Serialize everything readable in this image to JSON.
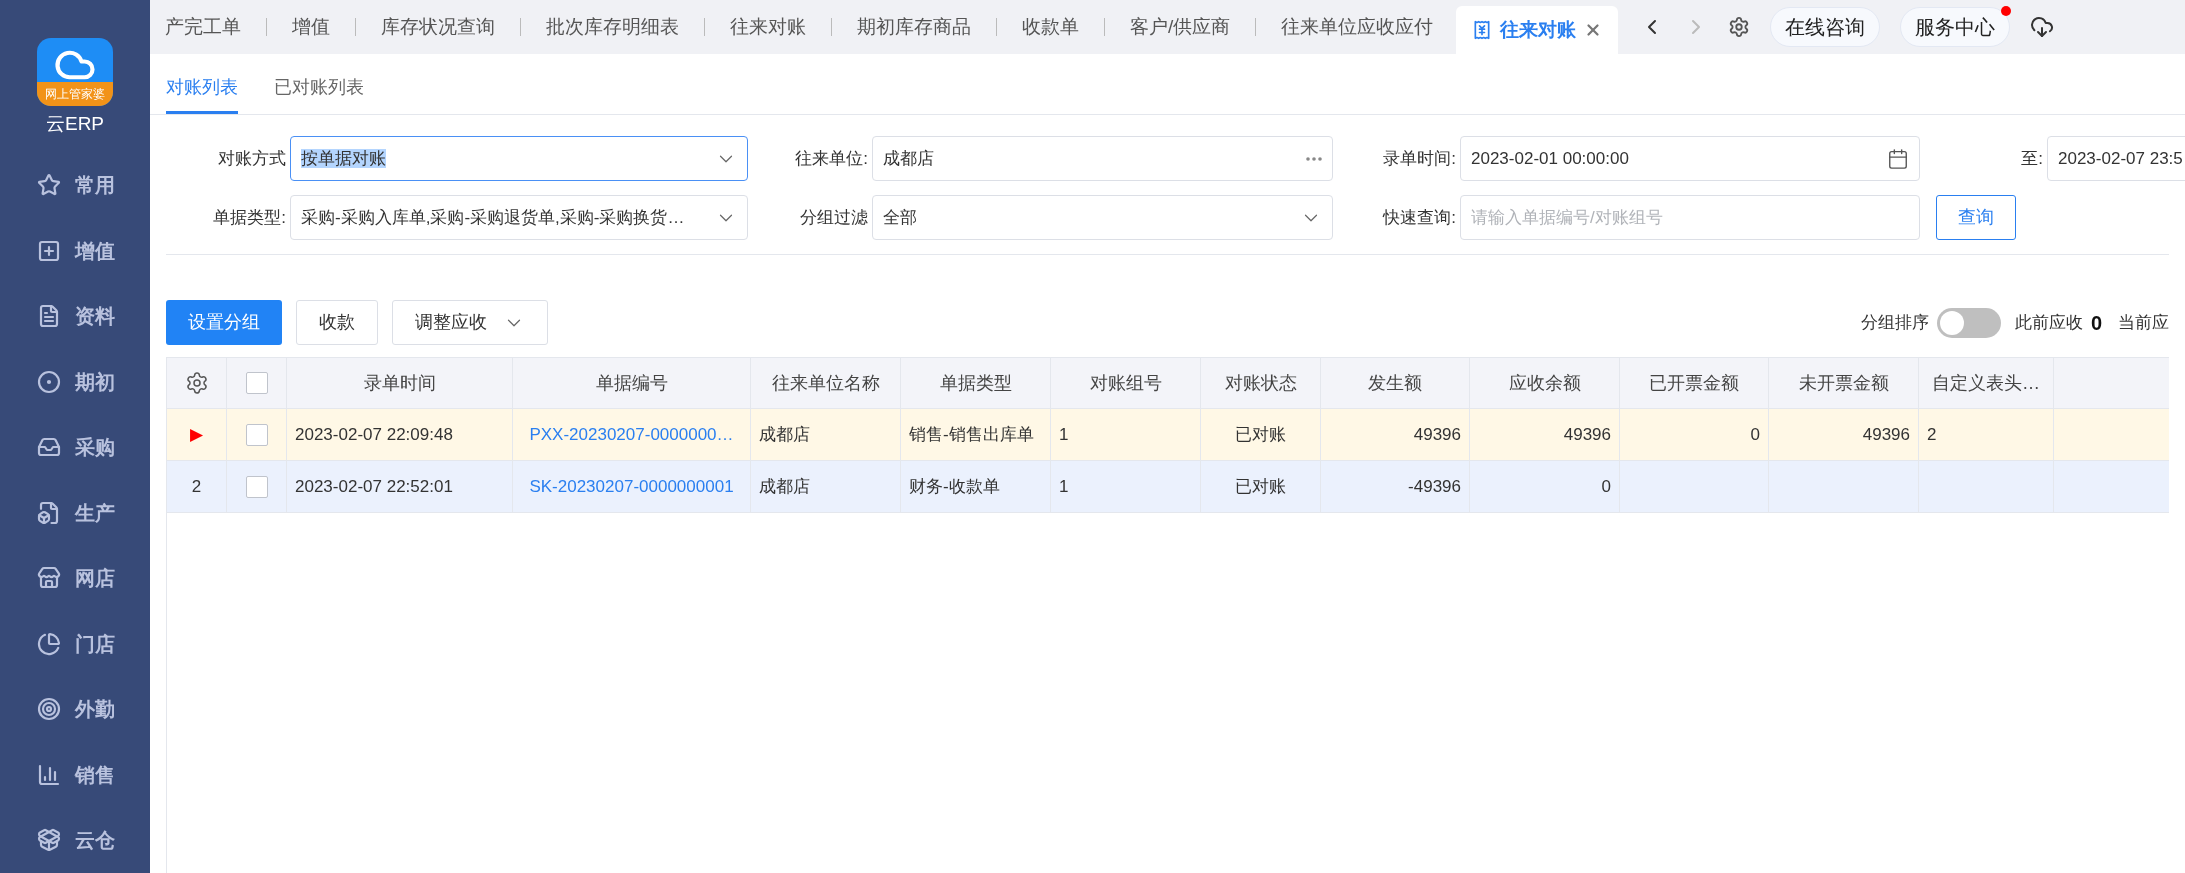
{
  "sidebar": {
    "logo_caption": "网上管家婆",
    "brand": "云ERP",
    "items": [
      {
        "label": "常用"
      },
      {
        "label": "增值"
      },
      {
        "label": "资料"
      },
      {
        "label": "期初"
      },
      {
        "label": "采购"
      },
      {
        "label": "生产"
      },
      {
        "label": "网店"
      },
      {
        "label": "门店"
      },
      {
        "label": "外勤"
      },
      {
        "label": "销售"
      },
      {
        "label": "云仓"
      }
    ]
  },
  "top_tabs": [
    {
      "label": "产完工单",
      "selected": false
    },
    {
      "label": "增值",
      "selected": false
    },
    {
      "label": "库存状况查询",
      "selected": false
    },
    {
      "label": "批次库存明细表",
      "selected": false
    },
    {
      "label": "往来对账",
      "selected": false
    },
    {
      "label": "期初库存商品",
      "selected": false
    },
    {
      "label": "收款单",
      "selected": false
    },
    {
      "label": "客户/供应商",
      "selected": false
    },
    {
      "label": "往来单位应收应付",
      "selected": false
    },
    {
      "label": "往来对账",
      "selected": true
    }
  ],
  "top_buttons": [
    {
      "label": "在线咨询",
      "notify": false
    },
    {
      "label": "服务中心",
      "notify": true
    }
  ],
  "sub_tabs": [
    {
      "label": "对账列表",
      "selected": true
    },
    {
      "label": "已对账列表",
      "selected": false
    }
  ],
  "filters": {
    "row1": [
      {
        "label": "对账方式",
        "kind": "select",
        "value": "按单据对账",
        "focused": true
      },
      {
        "label": "往来单位:",
        "kind": "picker",
        "value": "成都店"
      },
      {
        "label": "录单时间:",
        "kind": "date",
        "value": "2023-02-01 00:00:00"
      },
      {
        "label": "至:",
        "kind": "date",
        "value": "2023-02-07 23:5"
      }
    ],
    "row2": [
      {
        "label": "单据类型:",
        "kind": "select",
        "value": "采购-采购入库单,采购-采购退货单,采购-采购换货…",
        "focused": false
      },
      {
        "label": "分组过滤",
        "kind": "select",
        "value": "全部",
        "focused": false
      },
      {
        "label": "快速查询:",
        "kind": "text",
        "placeholder": "请输入单据编号/对账组号"
      }
    ],
    "query_button": "查询"
  },
  "toolbar": {
    "buttons": [
      {
        "label": "设置分组",
        "kind": "primary"
      },
      {
        "label": "收款",
        "kind": "plain"
      },
      {
        "label": "调整应收",
        "kind": "dropdown"
      }
    ],
    "group_sort": {
      "label": "分组排序",
      "on": false
    },
    "prior_receivable_label": "此前应收",
    "prior_receivable_value": "0",
    "current_label": "当前应"
  },
  "table": {
    "all_checked": false,
    "columns": [
      "录单时间",
      "单据编号",
      "往来单位名称",
      "单据类型",
      "对账组号",
      "对账状态",
      "发生额",
      "应收余额",
      "已开票金额",
      "未开票金额",
      "自定义表头…"
    ],
    "rows": [
      {
        "index": "▶",
        "selected": true,
        "checked": false,
        "cells": [
          "2023-02-07 22:09:48",
          "PXX-20230207-0000000…",
          "成都店",
          "销售-销售出库单",
          "1",
          "已对账",
          "49396",
          "49396",
          "0",
          "49396",
          "2"
        ]
      },
      {
        "index": "2",
        "selected": false,
        "checked": false,
        "cells": [
          "2023-02-07 22:52:01",
          "SK-20230207-0000000001",
          "成都店",
          "财务-收款单",
          "1",
          "已对账",
          "-49396",
          "0",
          "",
          "",
          ""
        ]
      }
    ]
  }
}
